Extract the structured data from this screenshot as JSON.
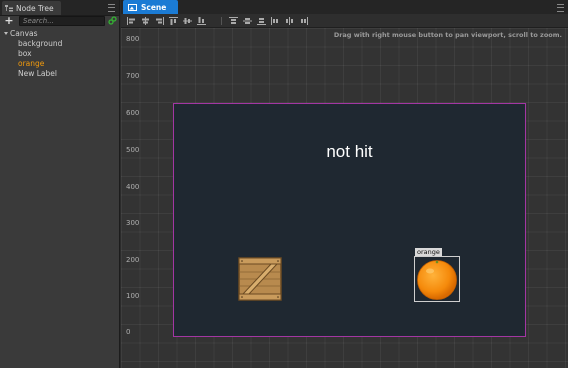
{
  "node_tree": {
    "tab_label": "Node Tree",
    "tab_icon": "node-tree-icon",
    "add_label": "+",
    "search_placeholder": "Search...",
    "items": [
      {
        "label": "Canvas",
        "expanded": true
      },
      {
        "label": "background"
      },
      {
        "label": "box"
      },
      {
        "label": "orange",
        "selected": true
      },
      {
        "label": "New Label"
      }
    ]
  },
  "scene": {
    "tab_label": "Scene",
    "tab_icon": "scene-icon",
    "hint": "Drag with right mouse button to pan viewport, scroll to zoom.",
    "ruler": [
      "800",
      "700",
      "600",
      "500",
      "400",
      "300",
      "200",
      "100",
      "0"
    ],
    "label_text": "not hit",
    "orange_name_tag": "orange"
  },
  "colors": {
    "accent": "#1b7bd4",
    "selected_node": "#f39b0c",
    "canvas_border": "#a336a3",
    "canvas_bg": "#1f2831"
  }
}
